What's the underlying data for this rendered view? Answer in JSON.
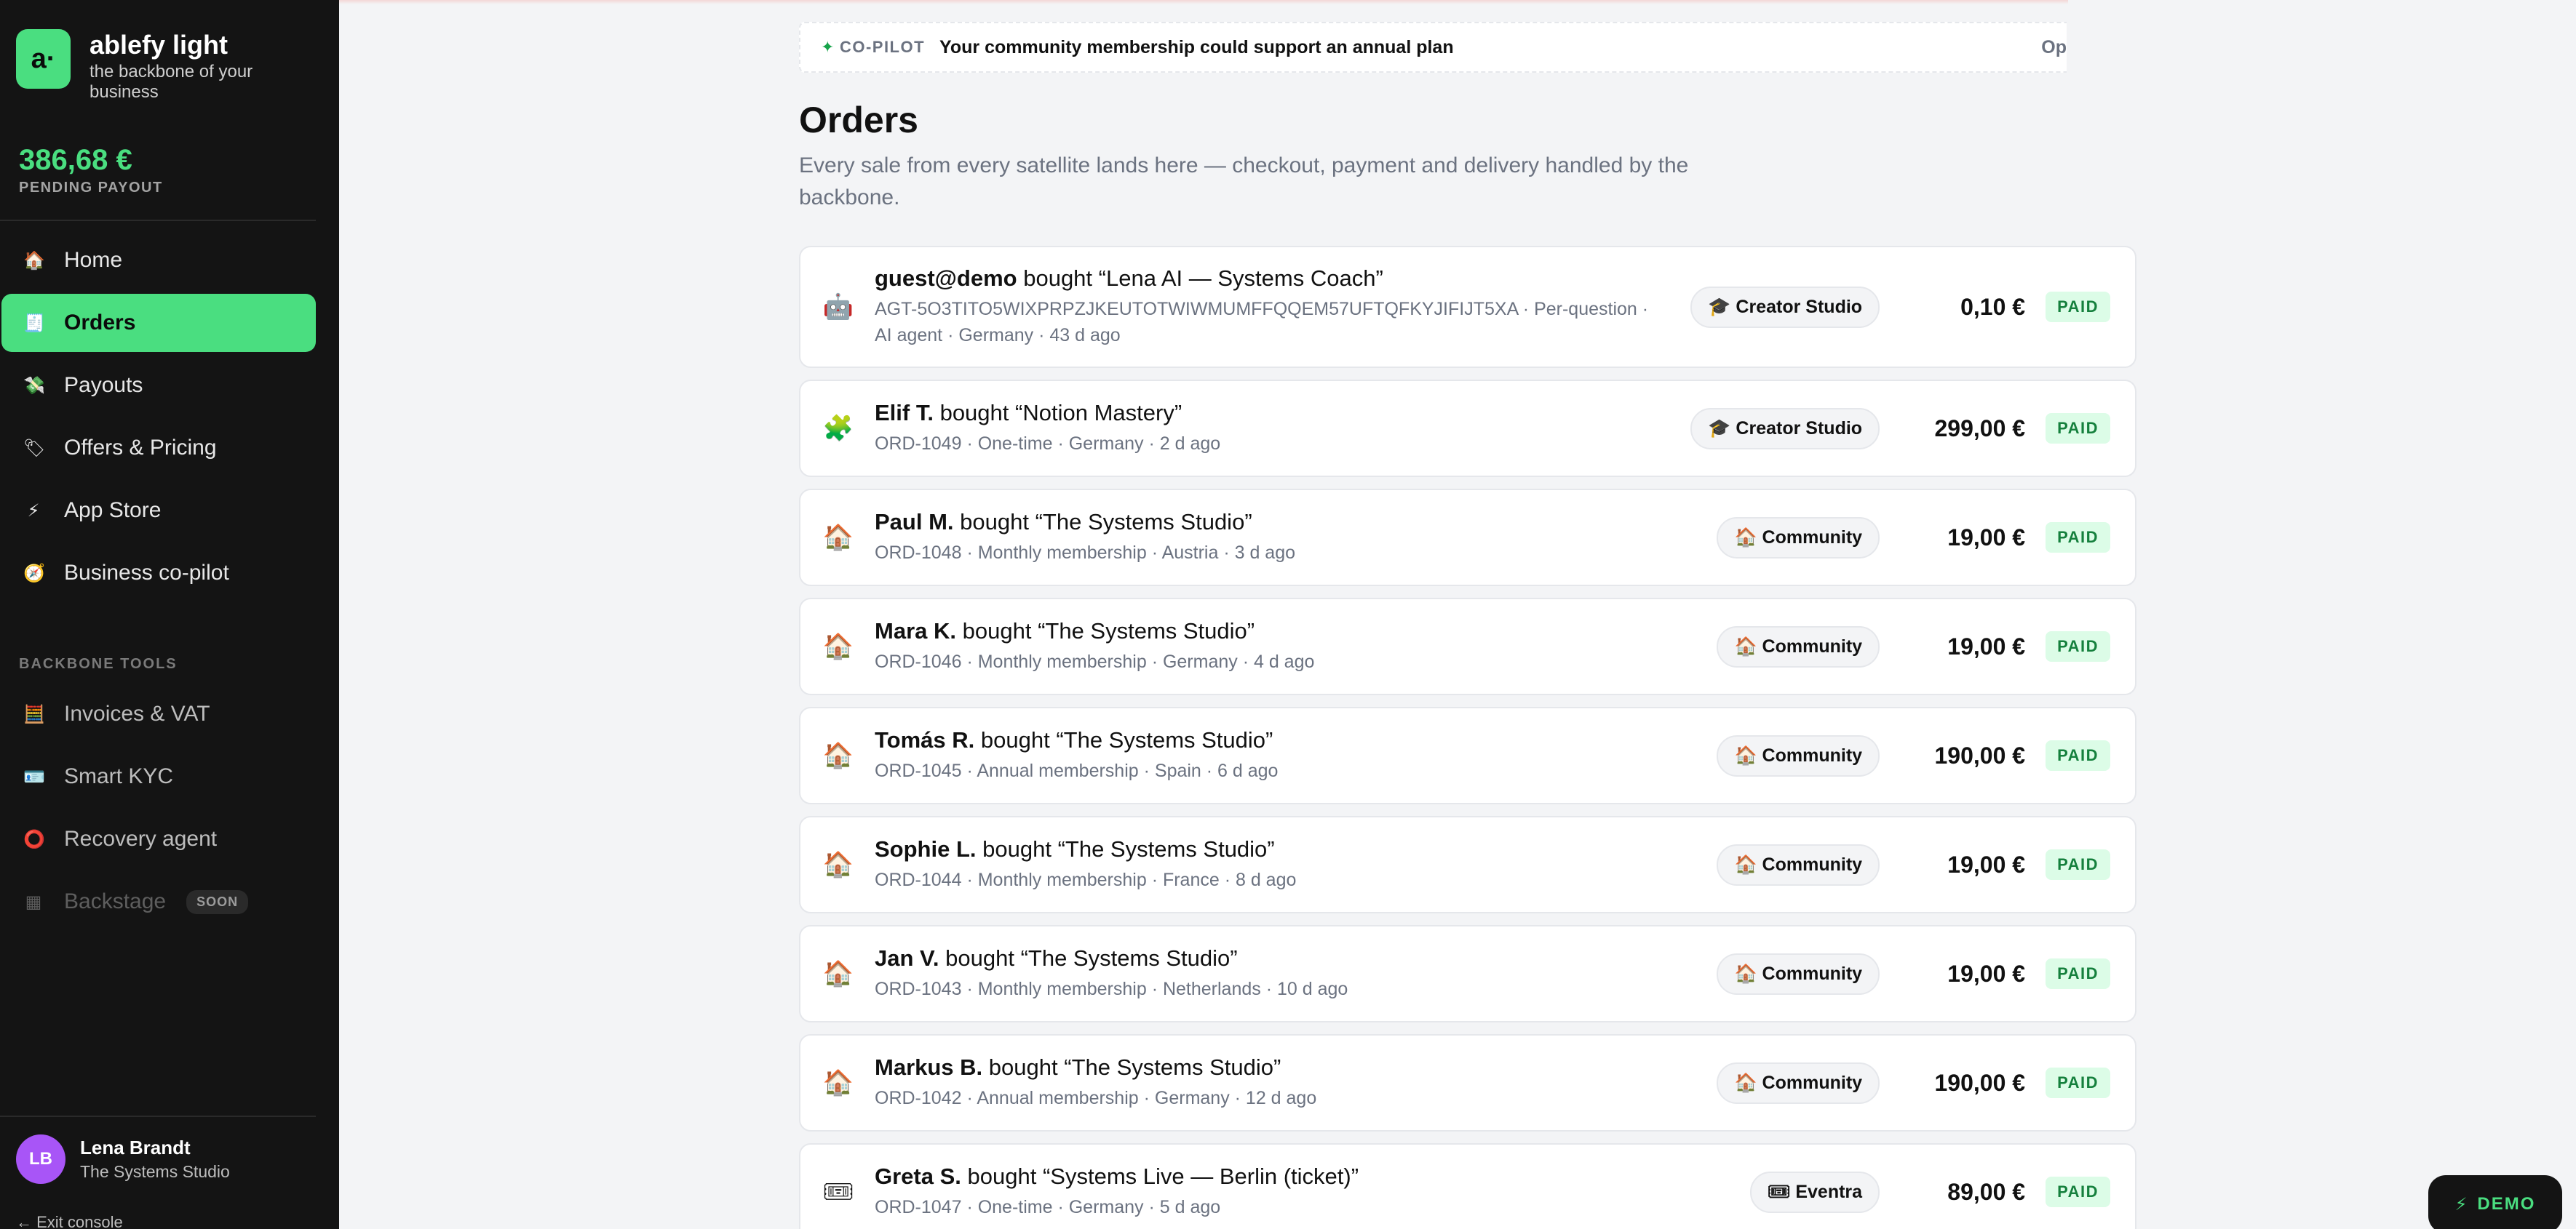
{
  "brand": {
    "logo": "a·",
    "name": "ablefy light",
    "tagline": "the backbone of your business"
  },
  "payout": {
    "amount": "386,68 €",
    "label": "PENDING PAYOUT"
  },
  "nav": [
    {
      "label": "Home",
      "icon": "🏠"
    },
    {
      "label": "Orders",
      "icon": "🧾"
    },
    {
      "label": "Payouts",
      "icon": "💸"
    },
    {
      "label": "Offers & Pricing",
      "icon": "🏷"
    },
    {
      "label": "App Store",
      "icon": "⚡"
    },
    {
      "label": "Business co-pilot",
      "icon": "🧭"
    }
  ],
  "tools_label": "BACKBONE TOOLS",
  "tools": [
    {
      "label": "Invoices & VAT",
      "icon": "🧮"
    },
    {
      "label": "Smart KYC",
      "icon": "🪪"
    },
    {
      "label": "Recovery agent",
      "icon": "⭕"
    },
    {
      "label": "Backstage",
      "icon": "▦",
      "badge": "SOON"
    }
  ],
  "user": {
    "initials": "LB",
    "name": "Lena Brandt",
    "studio": "The Systems Studio",
    "exit": "← Exit console"
  },
  "copilot": {
    "tag": "CO-PILOT",
    "spark": "✦",
    "message": "Your community membership could support an annual plan",
    "action": "Op"
  },
  "page": {
    "title": "Orders",
    "subtitle": "Every sale from every satellite lands here — checkout, payment and delivery handled by the backbone."
  },
  "orders": [
    {
      "icon": "🤖",
      "buyer": "guest@demo",
      "verb": "bought",
      "product": "“Lena AI — Systems Coach”",
      "meta": "AGT-5O3TITO5WIXPRPZJKEUTOTWIWMUMFFQQEM57UFTQFKYJIFIJT5XA · Per-question · AI agent · Germany · 43 d ago",
      "source": "🎓 Creator Studio",
      "amount": "0,10 €",
      "status": "PAID"
    },
    {
      "icon": "🧩",
      "buyer": "Elif T.",
      "verb": "bought",
      "product": "“Notion Mastery”",
      "meta": "ORD-1049 · One-time · Germany · 2 d ago",
      "source": "🎓 Creator Studio",
      "amount": "299,00 €",
      "status": "PAID"
    },
    {
      "icon": "🏠",
      "buyer": "Paul M.",
      "verb": "bought",
      "product": "“The Systems Studio”",
      "meta": "ORD-1048 · Monthly membership · Austria · 3 d ago",
      "source": "🏠 Community",
      "amount": "19,00 €",
      "status": "PAID"
    },
    {
      "icon": "🏠",
      "buyer": "Mara K.",
      "verb": "bought",
      "product": "“The Systems Studio”",
      "meta": "ORD-1046 · Monthly membership · Germany · 4 d ago",
      "source": "🏠 Community",
      "amount": "19,00 €",
      "status": "PAID"
    },
    {
      "icon": "🏠",
      "buyer": "Tomás R.",
      "verb": "bought",
      "product": "“The Systems Studio”",
      "meta": "ORD-1045 · Annual membership · Spain · 6 d ago",
      "source": "🏠 Community",
      "amount": "190,00 €",
      "status": "PAID"
    },
    {
      "icon": "🏠",
      "buyer": "Sophie L.",
      "verb": "bought",
      "product": "“The Systems Studio”",
      "meta": "ORD-1044 · Monthly membership · France · 8 d ago",
      "source": "🏠 Community",
      "amount": "19,00 €",
      "status": "PAID"
    },
    {
      "icon": "🏠",
      "buyer": "Jan V.",
      "verb": "bought",
      "product": "“The Systems Studio”",
      "meta": "ORD-1043 · Monthly membership · Netherlands · 10 d ago",
      "source": "🏠 Community",
      "amount": "19,00 €",
      "status": "PAID"
    },
    {
      "icon": "🏠",
      "buyer": "Markus B.",
      "verb": "bought",
      "product": "“The Systems Studio”",
      "meta": "ORD-1042 · Annual membership · Germany · 12 d ago",
      "source": "🏠 Community",
      "amount": "190,00 €",
      "status": "PAID"
    },
    {
      "icon": "🎟",
      "buyer": "Greta S.",
      "verb": "bought",
      "product": "“Systems Live — Berlin (ticket)”",
      "meta": "ORD-1047 · One-time · Germany · 5 d ago",
      "source": "🎟 Eventra",
      "amount": "89,00 €",
      "status": "PAID"
    }
  ],
  "demo": {
    "icon": "⚡",
    "label": "DEMO"
  },
  "colors": {
    "accent": "#4ade80",
    "sidebar": "#141414",
    "paid_bg": "#dcfce7",
    "paid_text": "#15803d"
  }
}
